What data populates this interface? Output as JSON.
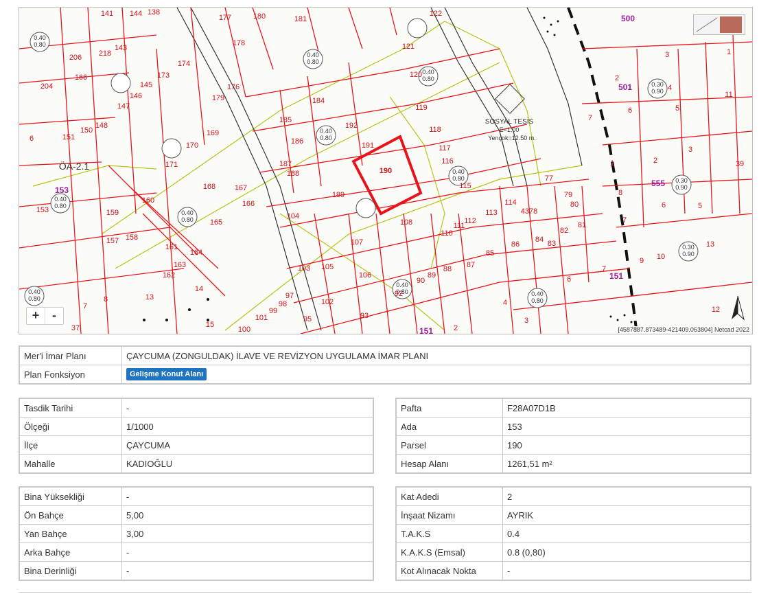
{
  "map": {
    "zoom_in": "+",
    "zoom_out": "-",
    "coordinate_text": "[4587887.873489-421409.063804] Netcad 2022",
    "selected_parcel": "190",
    "ada_labels": [
      "153",
      "151",
      "501",
      "555",
      "500"
    ],
    "area_labels": [
      "ÖA-2.1",
      "SOSYAL TESİS",
      "E=1.00",
      "Yençok=12.50 m."
    ],
    "colors": {
      "parcel_line": "#e8141c",
      "selected": "#e8141c",
      "zone_line": "#b8c21a",
      "ada": "#9b1ea0"
    }
  },
  "plan_table": [
    {
      "label": "Mer'i İmar Planı",
      "value": "ÇAYCUMA (ZONGULDAK) İLAVE VE REVİZYON UYGULAMA İMAR PLANI"
    },
    {
      "label": "Plan Fonksiyon",
      "value": "Gelişme Konut Alanı"
    }
  ],
  "left_table_1": [
    {
      "label": "Tasdik Tarihi",
      "value": "-"
    },
    {
      "label": "Ölçeği",
      "value": "1/1000"
    },
    {
      "label": "İlçe",
      "value": "ÇAYCUMA"
    },
    {
      "label": "Mahalle",
      "value": "KADIOĞLU"
    }
  ],
  "right_table_1": [
    {
      "label": "Pafta",
      "value": "F28A07D1B"
    },
    {
      "label": "Ada",
      "value": "153"
    },
    {
      "label": "Parsel",
      "value": "190"
    },
    {
      "label": "Hesap Alanı",
      "value": "1261,51 m²"
    }
  ],
  "left_table_2": [
    {
      "label": "Bina Yüksekliği",
      "value": "-"
    },
    {
      "label": "Ön Bahçe",
      "value": "5,00"
    },
    {
      "label": "Yan Bahçe",
      "value": "3,00"
    },
    {
      "label": "Arka Bahçe",
      "value": "-"
    },
    {
      "label": "Bina Derinliği",
      "value": "-"
    }
  ],
  "right_table_2": [
    {
      "label": "Kat Adedi",
      "value": "2"
    },
    {
      "label": "İnşaat Nizamı",
      "value": "AYRIK"
    },
    {
      "label": "T.A.K.S",
      "value": "0.4"
    },
    {
      "label": "K.A.K.S (Emsal)",
      "value": "0.8 (0,80)"
    },
    {
      "label": "Kot Alınacak Nokta",
      "value": "-"
    }
  ]
}
